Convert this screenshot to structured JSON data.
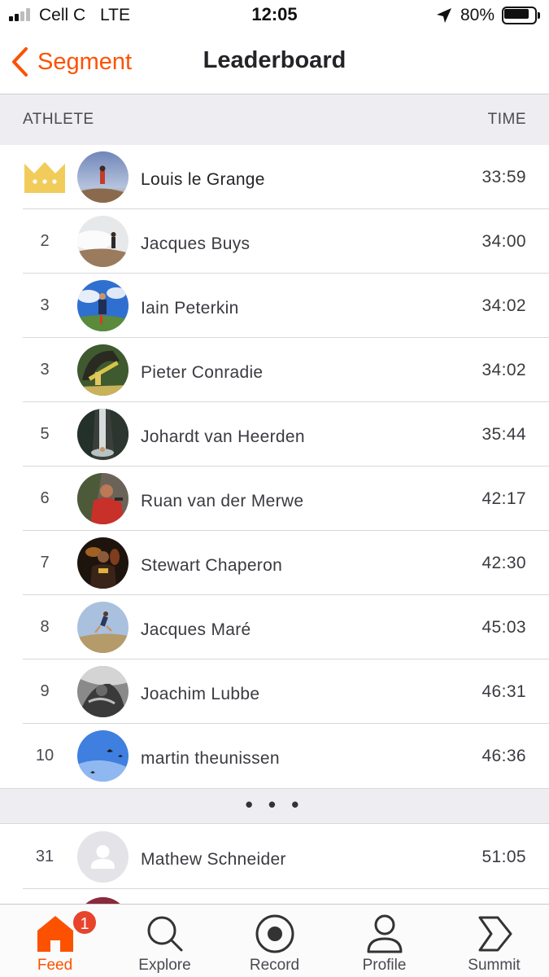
{
  "status_bar": {
    "carrier": "Cell C",
    "network": "LTE",
    "time": "12:05",
    "battery_percent": "80%",
    "battery_level": 0.8,
    "signal_bars": 2
  },
  "nav": {
    "back_label": "Segment",
    "title": "Leaderboard"
  },
  "columns": {
    "athlete": "ATHLETE",
    "time": "TIME"
  },
  "colors": {
    "accent": "#fc5200",
    "crown": "#f2cc5a",
    "badge": "#e8432b"
  },
  "leaderboard": [
    {
      "rank": "",
      "crown": true,
      "name": "Louis le Grange",
      "time": "33:59",
      "avatar": "avatar-runner-sky"
    },
    {
      "rank": "2",
      "name": "Jacques Buys",
      "time": "34:00",
      "avatar": "avatar-runner-clouds"
    },
    {
      "rank": "3",
      "name": "Iain Peterkin",
      "time": "34:02",
      "avatar": "avatar-runner-blue-sky"
    },
    {
      "rank": "3",
      "name": "Pieter Conradie",
      "time": "34:02",
      "avatar": "avatar-finish-arch"
    },
    {
      "rank": "5",
      "name": "Johardt van Heerden",
      "time": "35:44",
      "avatar": "avatar-waterfall"
    },
    {
      "rank": "6",
      "name": "Ruan van der Merwe",
      "time": "42:17",
      "avatar": "avatar-climber"
    },
    {
      "rank": "7",
      "name": "Stewart Chaperon",
      "time": "42:30",
      "avatar": "avatar-night-runner"
    },
    {
      "rank": "8",
      "name": "Jacques Maré",
      "time": "45:03",
      "avatar": "avatar-jumper"
    },
    {
      "rank": "9",
      "name": "Joachim Lubbe",
      "time": "46:31",
      "avatar": "avatar-bw-portrait"
    },
    {
      "rank": "10",
      "name": "martin theunissen",
      "time": "46:36",
      "avatar": "avatar-birds-sky"
    }
  ],
  "ellipsis": "• • •",
  "current_athlete": {
    "rank": "31",
    "name": "Mathew Schneider",
    "time": "51:05",
    "avatar": "default-avatar-icon"
  },
  "tabs": [
    {
      "label": "Feed",
      "icon": "home-icon",
      "active": true,
      "badge": "1"
    },
    {
      "label": "Explore",
      "icon": "magnifier-icon",
      "active": false
    },
    {
      "label": "Record",
      "icon": "record-icon",
      "active": false
    },
    {
      "label": "Profile",
      "icon": "person-icon",
      "active": false
    },
    {
      "label": "Summit",
      "icon": "summit-chevron-icon",
      "active": false
    }
  ]
}
